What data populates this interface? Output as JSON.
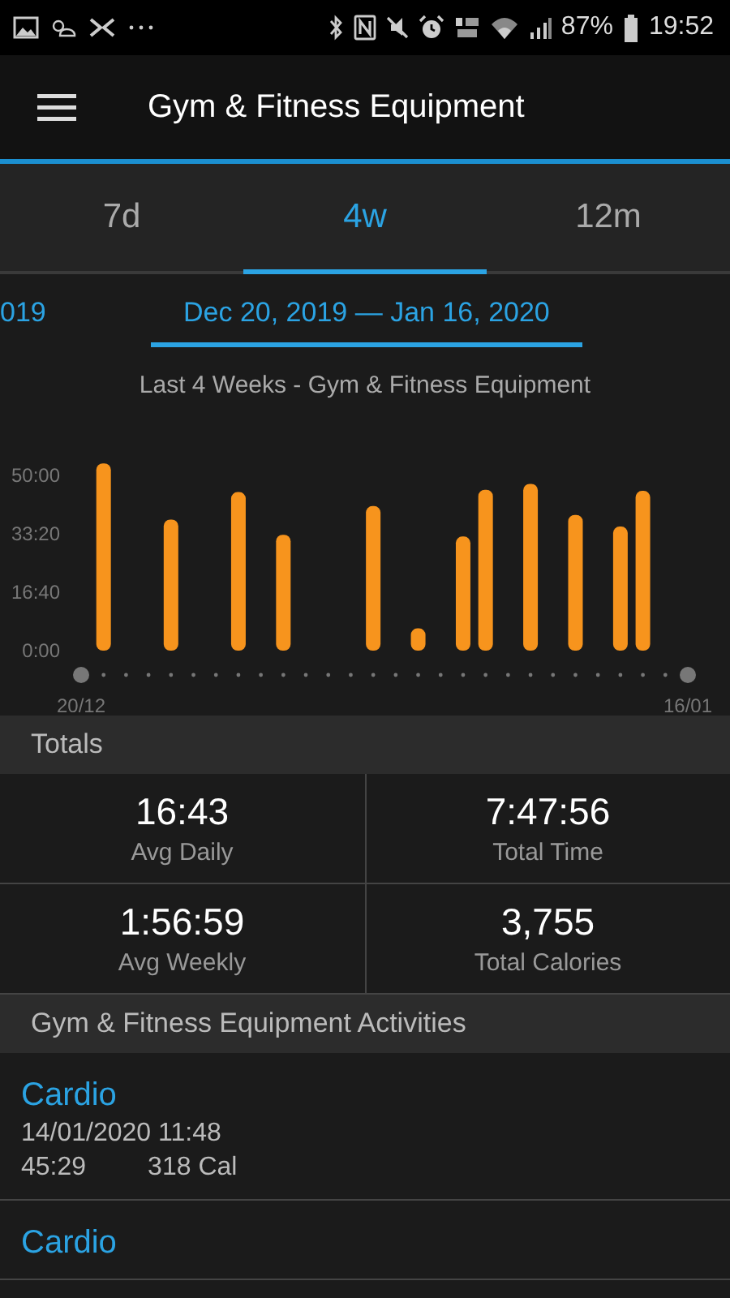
{
  "status_bar": {
    "battery": "87%",
    "time": "19:52"
  },
  "app_bar": {
    "title": "Gym & Fitness Equipment"
  },
  "tabs": [
    {
      "label": "7d",
      "selected": false
    },
    {
      "label": "4w",
      "selected": true
    },
    {
      "label": "12m",
      "selected": false
    }
  ],
  "date_range": {
    "previous": "019",
    "current": "Dec 20, 2019 — Jan 16, 2020"
  },
  "chart": {
    "chart_data": {
      "type": "bar",
      "title": "Last 4 Weeks - Gym & Fitness Equipment",
      "categories": [
        "20/12",
        null,
        null,
        null,
        null,
        null,
        null,
        null,
        null,
        null,
        null,
        null,
        null,
        null,
        null,
        null,
        null,
        null,
        null,
        null,
        null,
        null,
        null,
        null,
        null,
        null,
        null,
        "16/01"
      ],
      "series": [
        {
          "color": "#f7941d",
          "values": [
            null,
            3200,
            null,
            null,
            2240,
            null,
            null,
            2710,
            null,
            1980,
            null,
            null,
            null,
            2470,
            null,
            380,
            null,
            1950,
            2750,
            null,
            2850,
            null,
            2320,
            null,
            2120,
            2730,
            null,
            null
          ]
        }
      ],
      "ylim": [
        0,
        3300
      ],
      "yticks": [
        {
          "value": 0,
          "label": "0:00"
        },
        {
          "value": 1000,
          "label": "16:40"
        },
        {
          "value": 2000,
          "label": "33:20"
        },
        {
          "value": 3000,
          "label": "50:00"
        }
      ]
    }
  },
  "totals": {
    "header": "Totals",
    "stats": [
      {
        "value": "16:43",
        "label": "Avg Daily"
      },
      {
        "value": "7:47:56",
        "label": "Total Time"
      },
      {
        "value": "1:56:59",
        "label": "Avg Weekly"
      },
      {
        "value": "3,755",
        "label": "Total Calories"
      }
    ]
  },
  "activities": {
    "header": "Gym & Fitness Equipment Activities",
    "items": [
      {
        "name": "Cardio",
        "datetime": "14/01/2020 11:48",
        "duration": "45:29",
        "calories": "318 Cal"
      },
      {
        "name": "Cardio"
      }
    ]
  }
}
